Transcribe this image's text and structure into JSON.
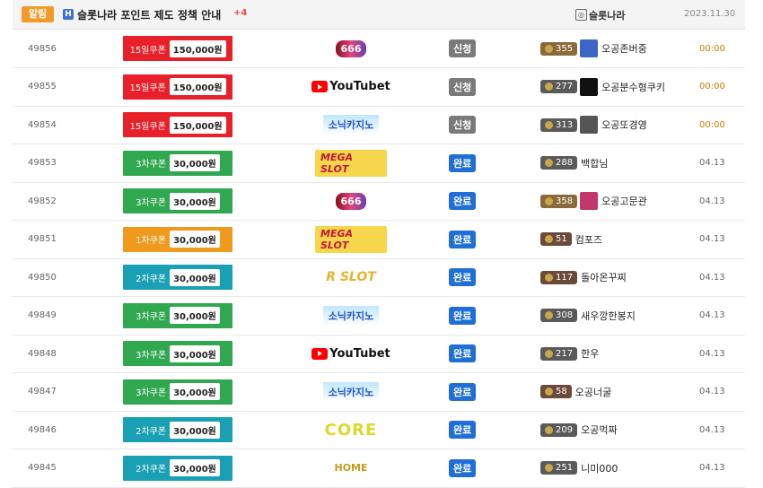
{
  "notice": {
    "tag": "알림",
    "icon": "H",
    "title": "슬롯나라 포인트 제도 정책 안내",
    "comment_count": "+4",
    "author": "슬롯나라",
    "date": "2023.11.30"
  },
  "colors": {
    "red": "#e8202a",
    "green": "#2fa84f",
    "orange": "#f09a1d",
    "teal": "#1aa0b5",
    "status_pending": "#7a7a7a",
    "status_done": "#1f6fd6",
    "time_orange": "#c97900",
    "time_gray": "#666666"
  },
  "rows": [
    {
      "num": "49856",
      "coupon": "15일쿠폰",
      "amount": "150,000원",
      "color": "red",
      "logo": "666",
      "status": "신청",
      "status_type": "pending",
      "level": "355",
      "level_color": "#8a6a3a",
      "avatar": "#3b66c5",
      "user": "오공존버중",
      "time": "00:00",
      "time_type": "orange"
    },
    {
      "num": "49855",
      "coupon": "15일쿠폰",
      "amount": "150,000원",
      "color": "red",
      "logo": "YouTubet",
      "status": "신청",
      "status_type": "pending",
      "level": "277",
      "level_color": "#5a5a5a",
      "avatar": "#111111",
      "user": "오공분수형쿠키",
      "time": "00:00",
      "time_type": "orange"
    },
    {
      "num": "49854",
      "coupon": "15일쿠폰",
      "amount": "150,000원",
      "color": "red",
      "logo": "소닉카지노",
      "status": "신청",
      "status_type": "pending",
      "level": "313",
      "level_color": "#5a5a5a",
      "avatar": "#555555",
      "user": "오공또경영",
      "time": "00:00",
      "time_type": "orange"
    },
    {
      "num": "49853",
      "coupon": "3차쿠폰",
      "amount": "30,000원",
      "color": "green",
      "logo": "MEGA SLOT",
      "status": "완료",
      "status_type": "done",
      "level": "288",
      "level_color": "#5a5a5a",
      "avatar": "",
      "user": "백합님",
      "time": "04.13",
      "time_type": "gray"
    },
    {
      "num": "49852",
      "coupon": "3차쿠폰",
      "amount": "30,000원",
      "color": "green",
      "logo": "666",
      "status": "완료",
      "status_type": "done",
      "level": "358",
      "level_color": "#8a6a3a",
      "avatar": "#c2386b",
      "user": "오공고문관",
      "time": "04.13",
      "time_type": "gray"
    },
    {
      "num": "49851",
      "coupon": "1차쿠폰",
      "amount": "30,000원",
      "color": "orange",
      "logo": "MEGA SLOT",
      "status": "완료",
      "status_type": "done",
      "level": "51",
      "level_color": "#6b4a3a",
      "avatar": "",
      "user": "컴포즈",
      "time": "04.13",
      "time_type": "gray"
    },
    {
      "num": "49850",
      "coupon": "2차쿠폰",
      "amount": "30,000원",
      "color": "teal",
      "logo": "R SLOT",
      "status": "완료",
      "status_type": "done",
      "level": "117",
      "level_color": "#6b4a3a",
      "avatar": "",
      "user": "돌아온꾸찌",
      "time": "04.13",
      "time_type": "gray"
    },
    {
      "num": "49849",
      "coupon": "3차쿠폰",
      "amount": "30,000원",
      "color": "green",
      "logo": "소닉카지노",
      "status": "완료",
      "status_type": "done",
      "level": "308",
      "level_color": "#5a5a5a",
      "avatar": "",
      "user": "새우깡한봉지",
      "time": "04.13",
      "time_type": "gray"
    },
    {
      "num": "49848",
      "coupon": "3차쿠폰",
      "amount": "30,000원",
      "color": "green",
      "logo": "YouTubet",
      "status": "완료",
      "status_type": "done",
      "level": "217",
      "level_color": "#5a5a5a",
      "avatar": "",
      "user": "한우",
      "time": "04.13",
      "time_type": "gray"
    },
    {
      "num": "49847",
      "coupon": "3차쿠폰",
      "amount": "30,000원",
      "color": "green",
      "logo": "소닉카지노",
      "status": "완료",
      "status_type": "done",
      "level": "58",
      "level_color": "#6b4a3a",
      "avatar": "",
      "user": "오공너굴",
      "time": "04.13",
      "time_type": "gray"
    },
    {
      "num": "49846",
      "coupon": "2차쿠폰",
      "amount": "30,000원",
      "color": "teal",
      "logo": "CORE",
      "status": "완료",
      "status_type": "done",
      "level": "209",
      "level_color": "#5a5a5a",
      "avatar": "",
      "user": "오공먹짜",
      "time": "04.13",
      "time_type": "gray"
    },
    {
      "num": "49845",
      "coupon": "2차쿠폰",
      "amount": "30,000원",
      "color": "teal",
      "logo": "HOME",
      "status": "완료",
      "status_type": "done",
      "level": "251",
      "level_color": "#5a5a5a",
      "avatar": "",
      "user": "니미000",
      "time": "04.13",
      "time_type": "gray"
    }
  ]
}
